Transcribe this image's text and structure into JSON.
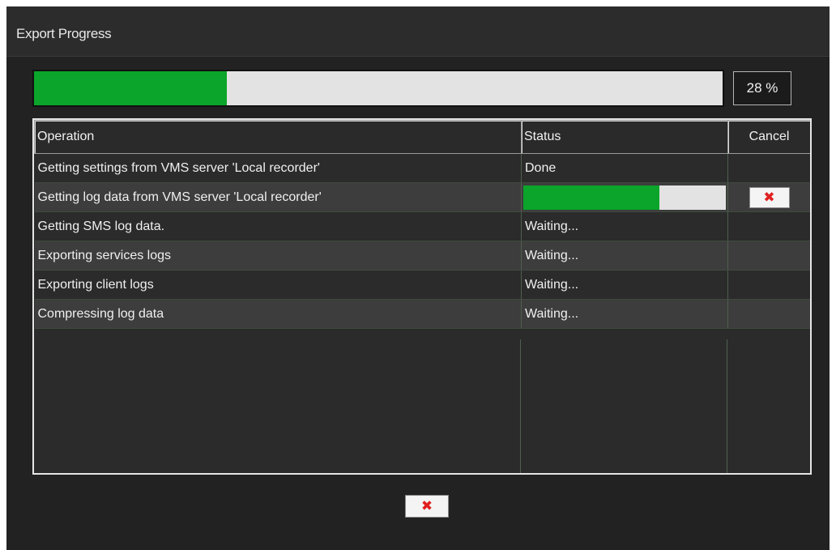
{
  "window": {
    "title": "Export Progress"
  },
  "overall_progress": {
    "value": 0.28,
    "label": "28 %"
  },
  "table": {
    "headers": {
      "operation": "Operation",
      "status": "Status",
      "cancel": "Cancel"
    },
    "rows": [
      {
        "operation": "Getting settings from VMS server 'Local recorder'",
        "status": "Done"
      },
      {
        "operation": "Getting log data from VMS server 'Local recorder'",
        "status": "",
        "progress": 0.67,
        "cancelable": true
      },
      {
        "operation": "Getting SMS log data.",
        "status": "Waiting..."
      },
      {
        "operation": "Exporting services logs",
        "status": "Waiting..."
      },
      {
        "operation": "Exporting client logs",
        "status": "Waiting..."
      },
      {
        "operation": "Compressing log data",
        "status": "Waiting..."
      }
    ]
  },
  "icons": {
    "cancel_row": "close-x-icon",
    "close_dialog": "close-x-icon"
  },
  "colors": {
    "progress_fill": "#0aa52a",
    "close_x": "#e02020",
    "background": "#222222"
  }
}
